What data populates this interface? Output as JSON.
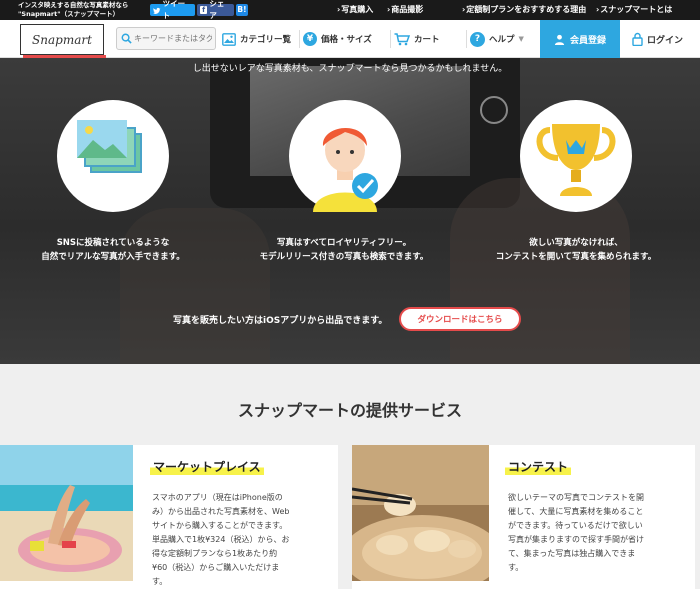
{
  "topbar": {
    "tagline_line1": "インスタ映えする自然な写真素材なら",
    "tagline_line2": "\"Snapmart\"（スナップマート）",
    "share_tweet": "ツイート",
    "share_facebook": "シェア",
    "share_hatena": "B!",
    "links": [
      "写真購入",
      "商品撮影",
      "定額制プランをおすすめする理由",
      "スナップマートとは"
    ]
  },
  "nav": {
    "logo_text": "Snapmart",
    "search_placeholder": "キーワードまたはタグ",
    "category": "カテゴリー覧",
    "price_size": "価格・サイズ",
    "cart": "カート",
    "help": "ヘルプ",
    "register": "会員登録",
    "login": "ログイン"
  },
  "hero": {
    "tagline": "し出せないレアな写真素材も、スナップマートなら見つかるかもしれません。",
    "features": [
      {
        "line1": "SNSに投稿されているような",
        "line2": "自然でリアルな写真が入手できます。"
      },
      {
        "line1": "写真はすべてロイヤリティフリー。",
        "line2": "モデルリリース付きの写真も検索できます。"
      },
      {
        "line1": "欲しい写真がなければ、",
        "line2": "コンテストを開いて写真を集められます。"
      }
    ],
    "sell_text": "写真を販売したい方はiOSアプリから出品できます。",
    "download_button": "ダウンロードはこちら"
  },
  "services": {
    "title": "スナップマートの提供サービス",
    "cards": [
      {
        "title": "マーケットプレイス",
        "lines": [
          "スマホのアプリ（現在はiPhone版の",
          "み）から出品された写真素材を、Web",
          "サイトから購入することができます。",
          "単品購入で1枚¥324（税込）から、お",
          "得な定額制プランなら1枚あたり約",
          "¥60（税込）からご購入いただけま",
          "す。"
        ]
      },
      {
        "title": "コンテスト",
        "lines": [
          "欲しいテーマの写真でコンテストを開",
          "催して、大量に写真素材を集めること",
          "ができます。待っているだけで欲しい",
          "写真が集まりますので探す手間が省け",
          "て、集まった写真は独占購入できま",
          "す。"
        ]
      }
    ]
  },
  "colors": {
    "brand_red": "#e54b4b",
    "register_blue": "#2ea7e0",
    "highlight_yellow": "#f7f24a",
    "twitter_blue": "#1d9bf0",
    "facebook_blue": "#3b5998"
  }
}
